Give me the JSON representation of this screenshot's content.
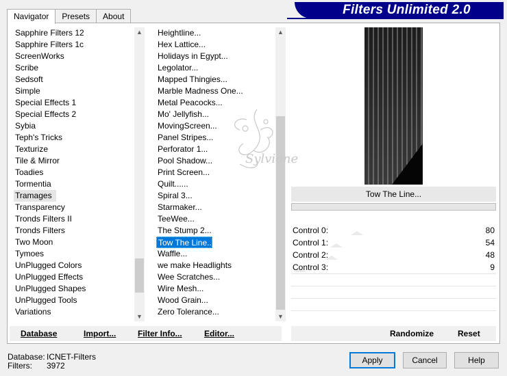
{
  "tabs": [
    "Navigator",
    "Presets",
    "About"
  ],
  "app_title": "Filters Unlimited 2.0",
  "categories": [
    "Sapphire Filters 12",
    "Sapphire Filters 1c",
    "ScreenWorks",
    "Scribe",
    "Sedsoft",
    "Simple",
    "Special Effects 1",
    "Special Effects 2",
    "Sybia",
    "Teph's Tricks",
    "Texturize",
    "Tile & Mirror",
    "Toadies",
    "Tormentia",
    "Tramages",
    "Transparency",
    "Tronds Filters II",
    "Tronds Filters",
    "Two Moon",
    "Tymoes",
    "UnPlugged Colors",
    "UnPlugged Effects",
    "UnPlugged Shapes",
    "UnPlugged Tools",
    "Variations"
  ],
  "selected_category": "Tramages",
  "filters": [
    "Heightline...",
    "Hex Lattice...",
    "Holidays in Egypt...",
    "Legolator...",
    "Mapped Thingies...",
    "Marble Madness One...",
    "Metal Peacocks...",
    "Mo' Jellyfish...",
    "MovingScreen...",
    "Panel Stripes...",
    "Perforator 1...",
    "Pool Shadow...",
    "Print Screen...",
    "Quilt......",
    "Spiral 3...",
    "Starmaker...",
    "TeeWee...",
    "The Stump 2...",
    "Tow The Line...",
    "Waffle...",
    "we make Headlights",
    "Wee Scratches...",
    "Wire Mesh...",
    "Wood Grain...",
    "Zero Tolerance..."
  ],
  "selected_filter": "Tow The Line...",
  "preview_label": "Tow The Line...",
  "watermark": "Sylviane",
  "controls": [
    {
      "label": "Control 0:",
      "value": "80",
      "level": 80
    },
    {
      "label": "Control 1:",
      "value": "54",
      "level": 54
    },
    {
      "label": "Control 2:",
      "value": "48",
      "level": 48
    },
    {
      "label": "Control 3:",
      "value": "9",
      "level": 9
    }
  ],
  "bottom_buttons": {
    "database": "Database",
    "import": "Import...",
    "filter_info": "Filter Info...",
    "editor": "Editor...",
    "randomize": "Randomize",
    "reset": "Reset"
  },
  "status": {
    "database_label": "Database:",
    "database_value": "ICNET-Filters",
    "filters_label": "Filters:",
    "filters_value": "3972"
  },
  "dialog_buttons": {
    "apply": "Apply",
    "cancel": "Cancel",
    "help": "Help"
  },
  "colors": {
    "title_bg": "#00008b",
    "selection": "#0078d7",
    "button_focus": "#0078d7"
  }
}
